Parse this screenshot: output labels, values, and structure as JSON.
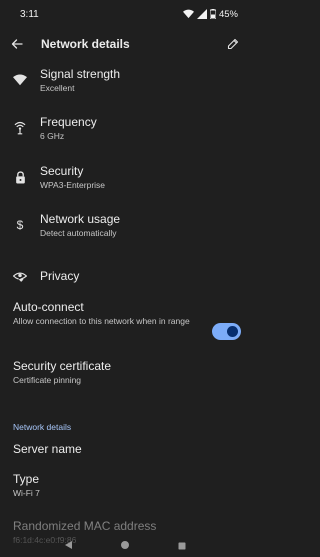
{
  "status_bar": {
    "time": "3:11",
    "battery": "45%"
  },
  "app_bar": {
    "title": "Network details"
  },
  "rows": {
    "signal": {
      "title": "Signal strength",
      "subtitle": "Excellent"
    },
    "frequency": {
      "title": "Frequency",
      "subtitle": "6 GHz"
    },
    "security": {
      "title": "Security",
      "subtitle": "WPA3-Enterprise"
    },
    "usage": {
      "title": "Network usage",
      "subtitle": "Detect automatically"
    },
    "privacy": {
      "title": "Privacy"
    },
    "autoconnect": {
      "title": "Auto-connect",
      "subtitle": "Allow connection to this network when in range",
      "enabled": true
    },
    "certificate": {
      "title": "Security certificate",
      "subtitle": "Certificate pinning"
    }
  },
  "section": {
    "network_details": "Network details"
  },
  "details": {
    "server_name": {
      "title": "Server name"
    },
    "type": {
      "title": "Type",
      "subtitle": "Wi-Fi 7"
    },
    "mac": {
      "title": "Randomized MAC address",
      "subtitle": "f6:1d:4c:e0:f9:86"
    }
  },
  "colors": {
    "accent": "#a8c7fa",
    "toggle_track": "#7cacf8",
    "background": "#1f1f1f"
  }
}
